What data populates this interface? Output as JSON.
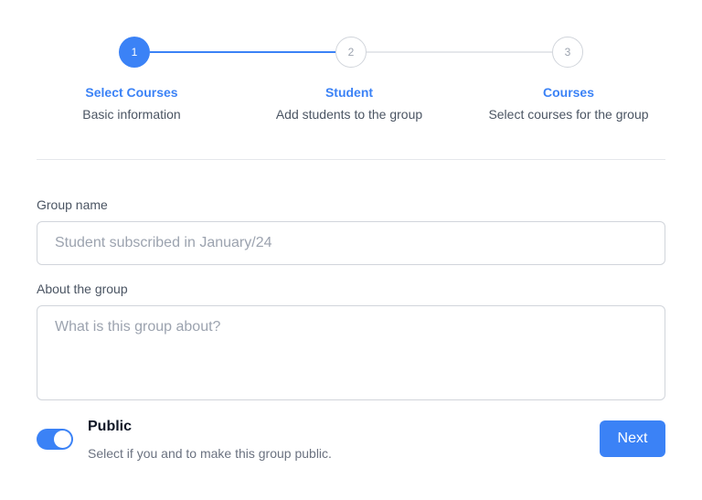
{
  "stepper": {
    "steps": [
      {
        "number": "1",
        "title": "Select Courses",
        "subtitle": "Basic information",
        "state": "active"
      },
      {
        "number": "2",
        "title": "Student",
        "subtitle": "Add students to the group",
        "state": "inactive"
      },
      {
        "number": "3",
        "title": "Courses",
        "subtitle": "Select courses for the group",
        "state": "inactive"
      }
    ]
  },
  "form": {
    "group_name": {
      "label": "Group name",
      "placeholder": "Student subscribed in January/24",
      "value": ""
    },
    "about": {
      "label": "About the group",
      "placeholder": "What is this group about?",
      "value": ""
    },
    "public": {
      "title": "Public",
      "description": "Select if you and to make this group public.",
      "enabled": true
    }
  },
  "actions": {
    "next_label": "Next"
  },
  "colors": {
    "accent": "#3b82f6",
    "border": "#d1d5db",
    "muted_text": "#6b7280"
  }
}
